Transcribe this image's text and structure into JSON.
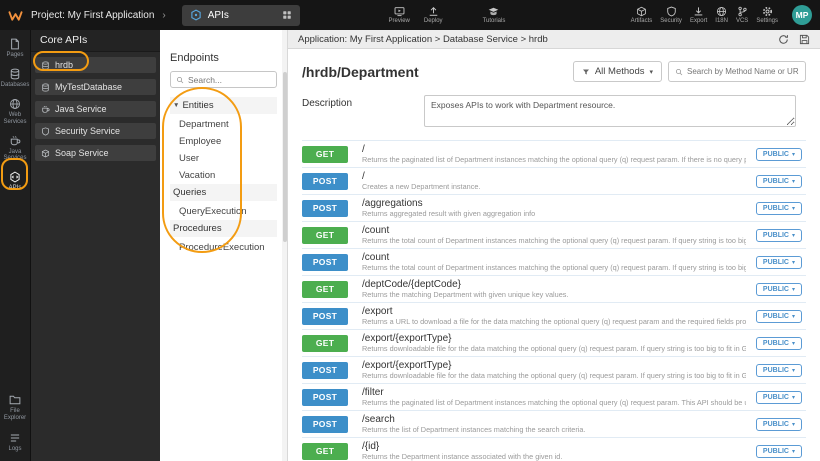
{
  "icons": {
    "chevron": "›",
    "caret_down": "▾",
    "tree_caret": "▼"
  },
  "topbar": {
    "project_label": "Project: My First Application",
    "workspace_tab": {
      "label": "APIs"
    },
    "center_actions": [
      {
        "label": "Preview"
      },
      {
        "label": "Deploy"
      },
      {
        "label": "Tutorials"
      }
    ],
    "right_actions": [
      {
        "label": "Artifacts"
      },
      {
        "label": "Security"
      },
      {
        "label": "Export"
      },
      {
        "label": "I18N"
      },
      {
        "label": "VCS"
      },
      {
        "label": "Settings"
      }
    ],
    "avatar_initials": "MP"
  },
  "left_rail": {
    "items": [
      {
        "label": "Pages"
      },
      {
        "label": "Databases"
      },
      {
        "label": "Web Services"
      },
      {
        "label": "Java Services"
      },
      {
        "label": "APIs",
        "highlighted": true
      },
      {
        "label": "File Explorer"
      },
      {
        "label": "Logs"
      }
    ]
  },
  "core_apis": {
    "title": "Core APIs",
    "items": [
      {
        "label": "hrdb",
        "highlighted": true
      },
      {
        "label": "MyTestDatabase"
      },
      {
        "label": "Java Service"
      },
      {
        "label": "Security Service"
      },
      {
        "label": "Soap Service"
      }
    ]
  },
  "endpoints": {
    "title": "Endpoints",
    "search_placeholder": "Search...",
    "tree": [
      {
        "label": "Entities",
        "type": "group",
        "caret": true
      },
      {
        "label": "Department",
        "type": "item"
      },
      {
        "label": "Employee",
        "type": "item"
      },
      {
        "label": "User",
        "type": "item"
      },
      {
        "label": "Vacation",
        "type": "item"
      },
      {
        "label": "Queries",
        "type": "group"
      },
      {
        "label": "QueryExecution",
        "type": "item"
      },
      {
        "label": "Procedures",
        "type": "group"
      },
      {
        "label": "ProcedureExecution",
        "type": "item"
      }
    ]
  },
  "main": {
    "breadcrumb": "Application: My First Application > Database Service > hrdb",
    "title": "/hrdb/Department",
    "methods_filter_label": "All Methods",
    "search_placeholder": "Search by Method Name or URL...",
    "description_label": "Description",
    "description_value": "Exposes APIs to work with Department resource.",
    "access_label": "PUBLIC",
    "colors": {
      "get": "#4cae4f",
      "post": "#3d8fc9",
      "accent_orange": "#f39c12",
      "avatar": "#2f9d96"
    },
    "rows": [
      {
        "method": "GET",
        "path": "/",
        "desc": "Returns the paginated list of Department instances matching the optional query (q) request param. If there is no query pro..."
      },
      {
        "method": "POST",
        "path": "/",
        "desc": "Creates a new Department instance."
      },
      {
        "method": "POST",
        "path": "/aggregations",
        "desc": "Returns aggregated result with given aggregation info"
      },
      {
        "method": "GET",
        "path": "/count",
        "desc": "Returns the total count of Department instances matching the optional query (q) request param. If query string is too big t..."
      },
      {
        "method": "POST",
        "path": "/count",
        "desc": "Returns the total count of Department instances matching the optional query (q) request param. If query string is too big t..."
      },
      {
        "method": "GET",
        "path": "/deptCode/{deptCode}",
        "desc": "Returns the matching Department with given unique key values."
      },
      {
        "method": "POST",
        "path": "/export",
        "desc": "Returns a URL to download a file for the data matching the optional query (q) request param and the required fields provid..."
      },
      {
        "method": "GET",
        "path": "/export/{exportType}",
        "desc": "Returns downloadable file for the data matching the optional query (q) request param. If query string is too big to fit in GET..."
      },
      {
        "method": "POST",
        "path": "/export/{exportType}",
        "desc": "Returns downloadable file for the data matching the optional query (q) request param. If query string is too big to fit in GET..."
      },
      {
        "method": "POST",
        "path": "/filter",
        "desc": "Returns the paginated list of Department instances matching the optional query (q) request param. This API should be use..."
      },
      {
        "method": "POST",
        "path": "/search",
        "desc": "Returns the list of Department instances matching the search criteria."
      },
      {
        "method": "GET",
        "path": "/{id}",
        "desc": "Returns the Department instance associated with the given id."
      }
    ]
  }
}
